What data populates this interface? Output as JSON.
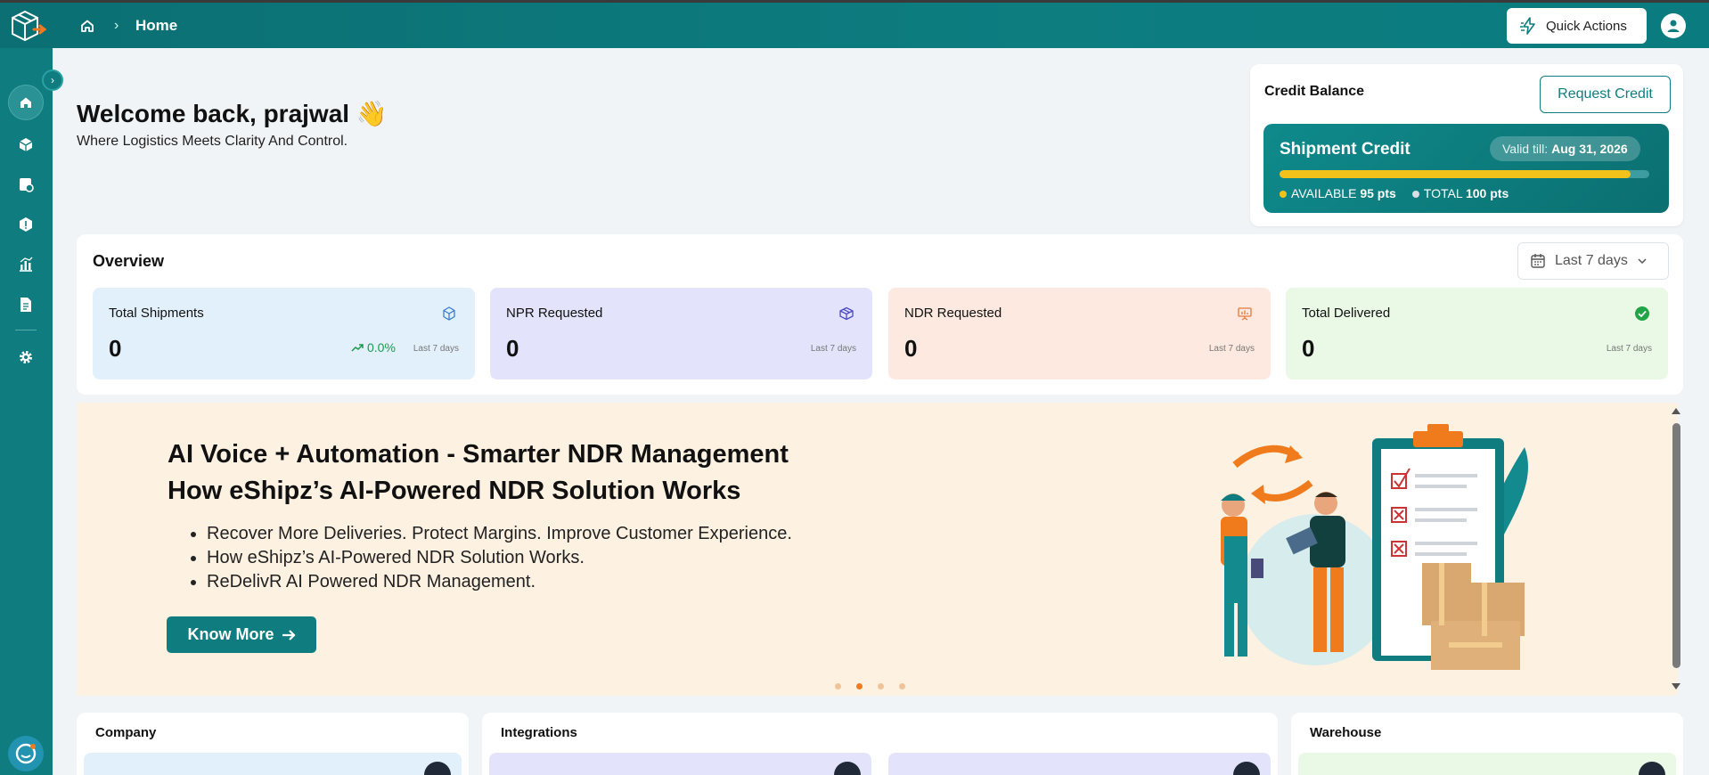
{
  "header": {
    "breadcrumb_title": "Home",
    "quick_actions_label": "Quick Actions"
  },
  "sidebar": {
    "items": [
      {
        "name": "home"
      },
      {
        "name": "shipments"
      },
      {
        "name": "orders"
      },
      {
        "name": "ndr"
      },
      {
        "name": "reports"
      },
      {
        "name": "documents"
      },
      {
        "name": "settings"
      }
    ]
  },
  "welcome": {
    "title": "Welcome back, prajwal 👋",
    "subtitle": "Where Logistics Meets Clarity And Control."
  },
  "credit": {
    "title": "Credit Balance",
    "request_label": "Request Credit",
    "shipment_title": "Shipment Credit",
    "valid_label": "Valid till:",
    "valid_date": "Aug 31, 2026",
    "available_label": "AVAILABLE",
    "available_value": "95 pts",
    "total_label": "TOTAL",
    "total_value": "100 pts",
    "fill_fraction": 0.95,
    "colors": {
      "fill": "#f2c21a",
      "track": "#3c9ca0"
    }
  },
  "overview": {
    "title": "Overview",
    "date_range": "Last 7 days",
    "cards": [
      {
        "label": "Total Shipments",
        "value": "0",
        "trend": "0.0%",
        "period": "Last 7 days",
        "bg": "#e2f0fc",
        "icon": "cube-icon"
      },
      {
        "label": "NPR Requested",
        "value": "0",
        "period": "Last 7 days",
        "bg": "#e3e4fb",
        "icon": "box-icon"
      },
      {
        "label": "NDR Requested",
        "value": "0",
        "period": "Last 7 days",
        "bg": "#fde9df",
        "icon": "presentation-icon"
      },
      {
        "label": "Total Delivered",
        "value": "0",
        "period": "Last 7 days",
        "bg": "#e9f9e6",
        "icon": "check-circle-icon"
      }
    ]
  },
  "banner": {
    "heading_line1": "AI Voice + Automation - Smarter NDR Management",
    "heading_line2": "How eShipz’s AI-Powered NDR Solution Works",
    "bullets": [
      "Recover More Deliveries. Protect Margins. Improve Customer Experience.",
      "How eShipz’s AI-Powered NDR Solution Works.",
      "ReDelivR AI Powered NDR Management."
    ],
    "cta_label": "Know More",
    "active_slide": 2,
    "slide_count": 4
  },
  "bottom": {
    "company_title": "Company",
    "integrations_title": "Integrations",
    "warehouse_title": "Warehouse"
  }
}
